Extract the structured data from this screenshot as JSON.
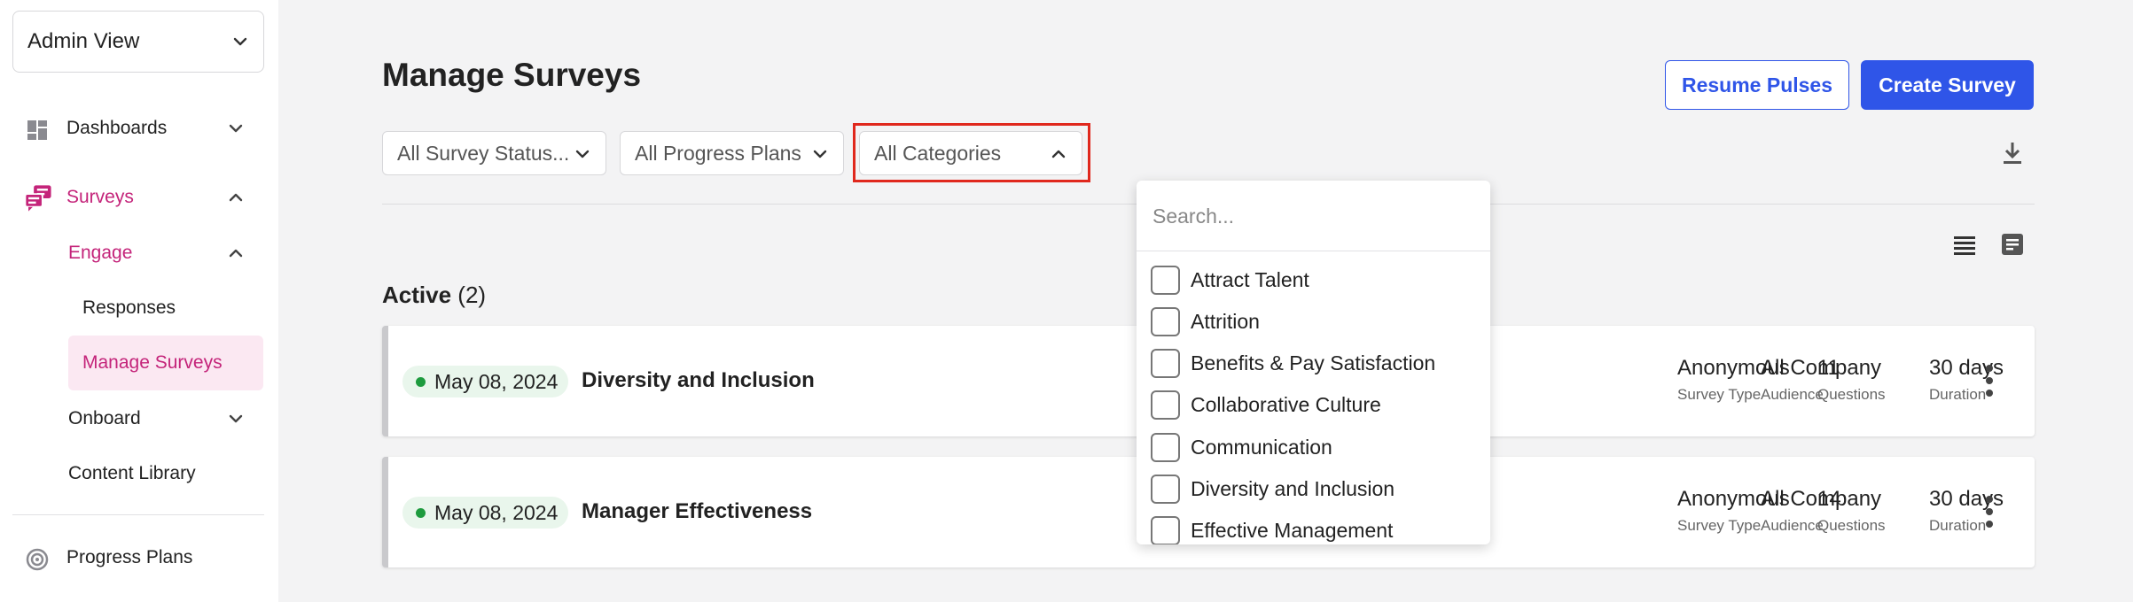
{
  "sidebar": {
    "view_select": "Admin View",
    "nav": {
      "dashboards": "Dashboards",
      "surveys": "Surveys",
      "engage": "Engage",
      "responses": "Responses",
      "manage_surveys": "Manage Surveys",
      "onboard": "Onboard",
      "content_library": "Content Library",
      "progress_plans": "Progress Plans"
    }
  },
  "page": {
    "title": "Manage Surveys",
    "resume_button": "Resume Pulses",
    "create_button": "Create Survey"
  },
  "filters": {
    "status": "All Survey Status...",
    "plans": "All Progress Plans",
    "categories": "All Categories"
  },
  "dropdown": {
    "search_placeholder": "Search...",
    "options": [
      "Attract Talent",
      "Attrition",
      "Benefits & Pay Satisfaction",
      "Collaborative Culture",
      "Communication",
      "Diversity and Inclusion",
      "Effective Management"
    ]
  },
  "section": {
    "title": "Active",
    "count": "(2)"
  },
  "surveys": [
    {
      "date": "May 08, 2024",
      "name": "Diversity and Inclusion",
      "survey_type": "Anonymous",
      "survey_type_label": "Survey Type",
      "questions": "11",
      "questions_label": "Questions",
      "duration": "30 days",
      "duration_label": "Duration",
      "audience": "All Company",
      "audience_label": "Audience"
    },
    {
      "date": "May 08, 2024",
      "name": "Manager Effectiveness",
      "survey_type": "Anonymous",
      "survey_type_label": "Survey Type",
      "questions": "14",
      "questions_label": "Questions",
      "duration": "30 days",
      "duration_label": "Duration",
      "audience": "All Company",
      "audience_label": "Audience"
    }
  ],
  "colors": {
    "accent_pink": "#c4247a",
    "primary_blue": "#2f55e8",
    "status_green": "#1d9b3e",
    "highlight_red": "#e0281d"
  }
}
